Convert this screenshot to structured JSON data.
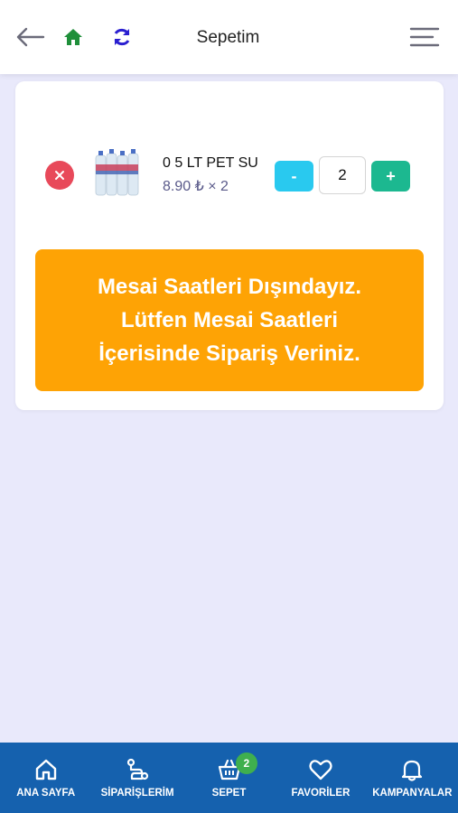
{
  "header": {
    "title": "Sepetim",
    "icons": {
      "back": "arrow-left-icon",
      "home": "home-icon",
      "refresh": "refresh-icon",
      "menu": "menu-icon"
    }
  },
  "cart": {
    "item": {
      "name": "0 5 LT PET SU",
      "price": "8.90 ₺ × 2",
      "quantity": "2"
    },
    "minus_label": "-",
    "plus_label": "+",
    "notice_lines": [
      "Mesai Saatleri Dışındayız.",
      "Lütfen Mesai Saatleri",
      "İçerisinde Sipariş Veriniz."
    ]
  },
  "bottom_nav": [
    {
      "label": "ANA SAYFA",
      "icon": "home-outline-icon"
    },
    {
      "label": "SİPARİŞLERİM",
      "icon": "route-icon"
    },
    {
      "label": "SEPET",
      "icon": "basket-icon",
      "badge": "2"
    },
    {
      "label": "FAVORİLER",
      "icon": "heart-icon"
    },
    {
      "label": "KAMPANYALAR",
      "icon": "bell-icon"
    }
  ],
  "colors": {
    "accent_blue": "#1561ae",
    "remove_red": "#e8495a",
    "minus_cyan": "#29c9ef",
    "plus_green": "#1cb890",
    "notice_orange": "#fea305",
    "badge_green": "#3faf4e",
    "home_green": "#1f8f3a",
    "refresh_blue": "#2a1fd0"
  }
}
